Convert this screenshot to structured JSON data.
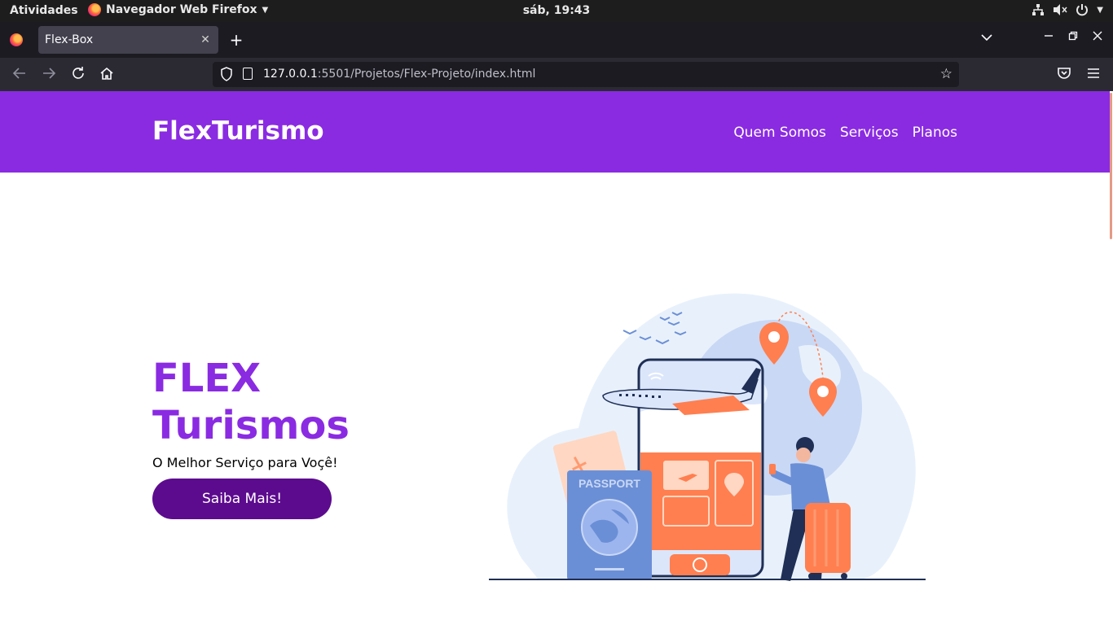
{
  "system_bar": {
    "activities": "Atividades",
    "app_name": "Navegador Web Firefox",
    "clock": "sáb, 19:43"
  },
  "browser": {
    "tab_title": "Flex-Box",
    "url_host": "127.0.0.1",
    "url_rest": ":5501/Projetos/Flex-Projeto/index.html"
  },
  "site": {
    "logo": "FlexTurismo",
    "nav": [
      "Quem Somos",
      "Serviços",
      "Planos"
    ],
    "hero": {
      "title_line1": "FLEX",
      "title_line2": "Turismos",
      "subtitle": "O Melhor Serviço para Voçê!",
      "button": "Saiba Mais!"
    },
    "illustration": {
      "passport_label": "PASSPORT"
    }
  },
  "colors": {
    "brand_purple": "#8a2be2",
    "button_purple": "#5c0b8e",
    "accent_orange": "#ff7f50"
  }
}
